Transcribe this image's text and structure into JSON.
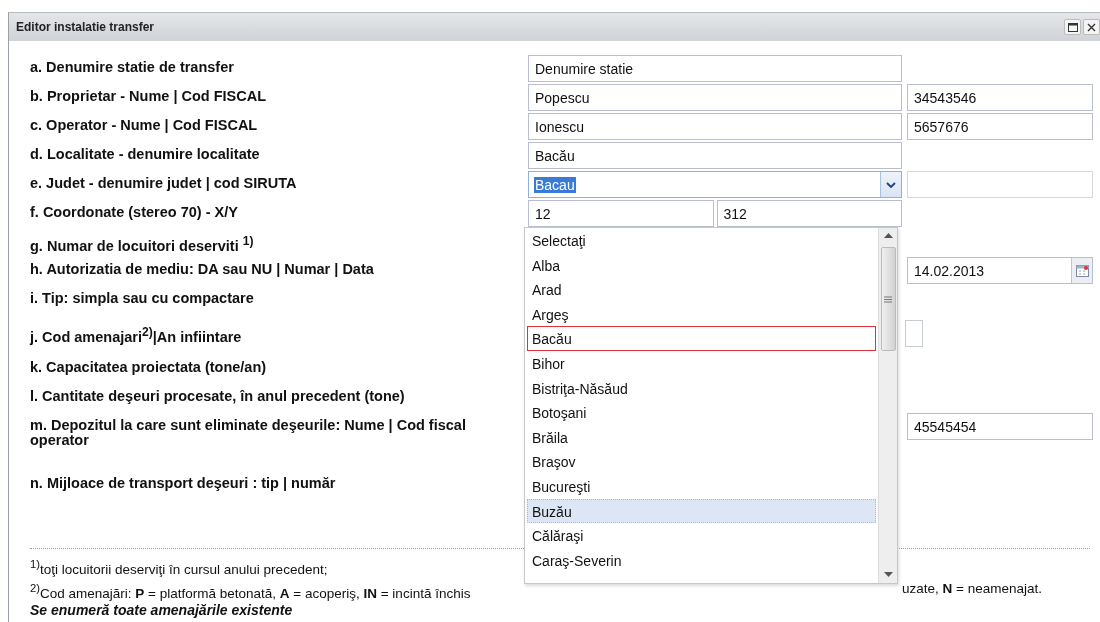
{
  "window": {
    "title": "Editor instalatie transfer"
  },
  "rows": [
    {
      "label": "a. Denumire statie de transfer",
      "fields": [
        {
          "kind": "wide",
          "value": "Denumire statie"
        }
      ]
    },
    {
      "label": "b. Proprietar - Nume | Cod FISCAL",
      "fields": [
        {
          "kind": "wide",
          "value": "Popescu"
        },
        {
          "kind": "side",
          "value": "34543546"
        }
      ]
    },
    {
      "label": "c. Operator - Nume | Cod FISCAL",
      "fields": [
        {
          "kind": "wide",
          "value": "Ionescu"
        },
        {
          "kind": "side",
          "value": "5657676"
        }
      ]
    },
    {
      "label": "d. Localitate - denumire localitate",
      "fields": [
        {
          "kind": "wide",
          "value": "Bacău"
        }
      ]
    },
    {
      "label": "e. Judet - denumire judet | cod SIRUTA",
      "fields": [
        {
          "kind": "combo",
          "value": "Bacau",
          "text_selected": true
        },
        {
          "kind": "side"
        }
      ]
    },
    {
      "label": "f. Coordonate (stereo 70) - X/Y",
      "fields": [
        {
          "kind": "half",
          "value": "12"
        },
        {
          "kind": "half",
          "value": "312"
        }
      ]
    },
    {
      "label": "g. Numar de locuitori deserviti $^{1)}$"
    },
    {
      "label": "h. Autorizatia de mediu: DA sau NU | Numar | Data",
      "fields": [
        {
          "kind": "date",
          "value": "14.02.2013"
        }
      ]
    },
    {
      "label": "i. Tip: simpla sau cu compactare"
    },
    {
      "label": "j. Cod amenajari$^{2)}$|An infiintare",
      "fields": [
        {
          "kind": "stub"
        }
      ]
    },
    {
      "label": "k. Capacitatea proiectata (tone/an)"
    },
    {
      "label": "l. Cantitate deşeuri procesate, în anul precedent (tone)"
    },
    {
      "label": "m. Depozitul la care sunt eliminate deşeurile: Nume | Cod fiscal operator",
      "fields": [
        {
          "kind": "side",
          "value": "45545454"
        }
      ]
    },
    {
      "label": "n. Mijloace de transport deşeuri : tip | număr"
    }
  ],
  "dropdown": {
    "items": [
      {
        "label": "Selectaţi",
        "selected": false,
        "hovered": false
      },
      {
        "label": "Alba",
        "selected": false,
        "hovered": false
      },
      {
        "label": "Arad",
        "selected": false,
        "hovered": false
      },
      {
        "label": "Argeş",
        "selected": false,
        "hovered": false
      },
      {
        "label": "Bacău",
        "selected": true,
        "hovered": false
      },
      {
        "label": "Bihor",
        "selected": false,
        "hovered": false
      },
      {
        "label": "Bistriţa-Năsăud",
        "selected": false,
        "hovered": false
      },
      {
        "label": "Botoşani",
        "selected": false,
        "hovered": false
      },
      {
        "label": "Brăila",
        "selected": false,
        "hovered": false
      },
      {
        "label": "Braşov",
        "selected": false,
        "hovered": false
      },
      {
        "label": "Bucureşti",
        "selected": false,
        "hovered": false
      },
      {
        "label": "Buzău",
        "selected": false,
        "hovered": true
      },
      {
        "label": "Călăraşi",
        "selected": false,
        "hovered": false
      },
      {
        "label": "Caraş-Severin",
        "selected": false,
        "hovered": false
      }
    ]
  },
  "footnotes": [
    {
      "text": "$^{1)}$toţi locuitorii deserviţi în cursul anului precedent;"
    },
    {
      "text": "$^{2)}$Cod amenajări: **P** = platformă betonată, **A** = acoperiş, **IN** = incintă închis",
      "tail": "uzate, **N** = neamenajat."
    }
  ],
  "note": "Se enumeră toate amenajările existente"
}
